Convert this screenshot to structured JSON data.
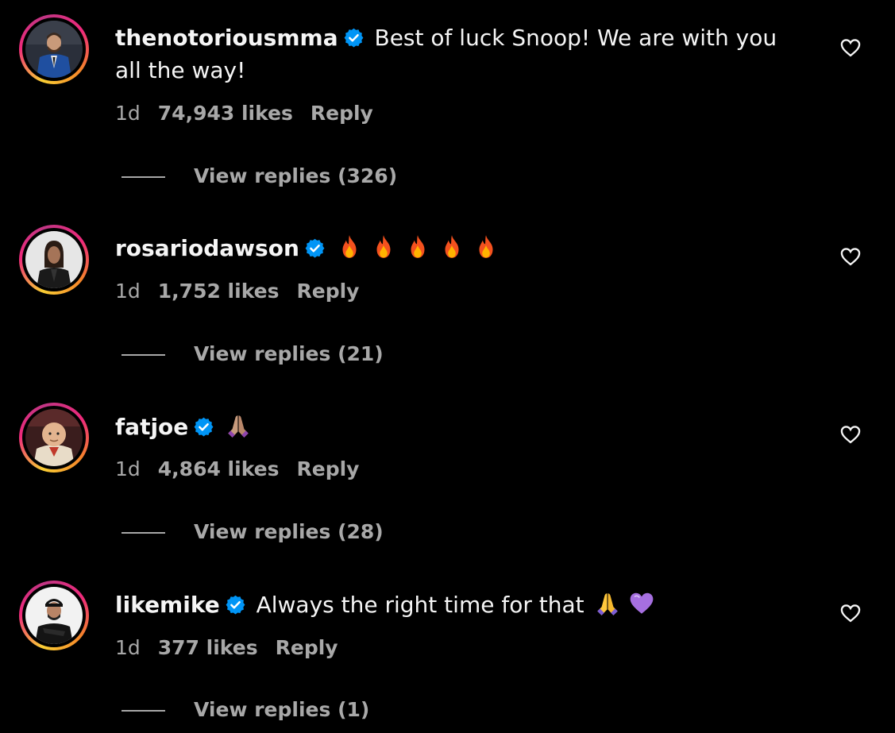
{
  "comments": [
    {
      "username": "thenotoriousmma",
      "text": "Best of luck Snoop! We are with you all the way!",
      "emojis": [],
      "time": "1d",
      "likes": "74,943 likes",
      "reply_label": "Reply",
      "view_replies": "View replies (326)",
      "avatar_icon": "avatar-man-blue-suit"
    },
    {
      "username": "rosariodawson",
      "text": "",
      "emojis": [
        "fire",
        "fire",
        "fire",
        "fire",
        "fire"
      ],
      "time": "1d",
      "likes": "1,752 likes",
      "reply_label": "Reply",
      "view_replies": "View replies (21)",
      "avatar_icon": "avatar-woman-dark-jacket"
    },
    {
      "username": "fatjoe",
      "text": "",
      "emojis": [
        "folded-hands-medium"
      ],
      "time": "1d",
      "likes": "4,864 likes",
      "reply_label": "Reply",
      "view_replies": "View replies (28)",
      "avatar_icon": "avatar-cartoon-man"
    },
    {
      "username": "likemike",
      "text": "Always the right time for that",
      "emojis": [
        "folded-hands",
        "purple-heart"
      ],
      "time": "1d",
      "likes": "377 likes",
      "reply_label": "Reply",
      "view_replies": "View replies (1)",
      "avatar_icon": "avatar-man-black-cap"
    }
  ],
  "colors": {
    "background": "#000000",
    "text": "#f5f5f5",
    "secondary": "#a8a8a8",
    "verified": "#0095f6"
  }
}
